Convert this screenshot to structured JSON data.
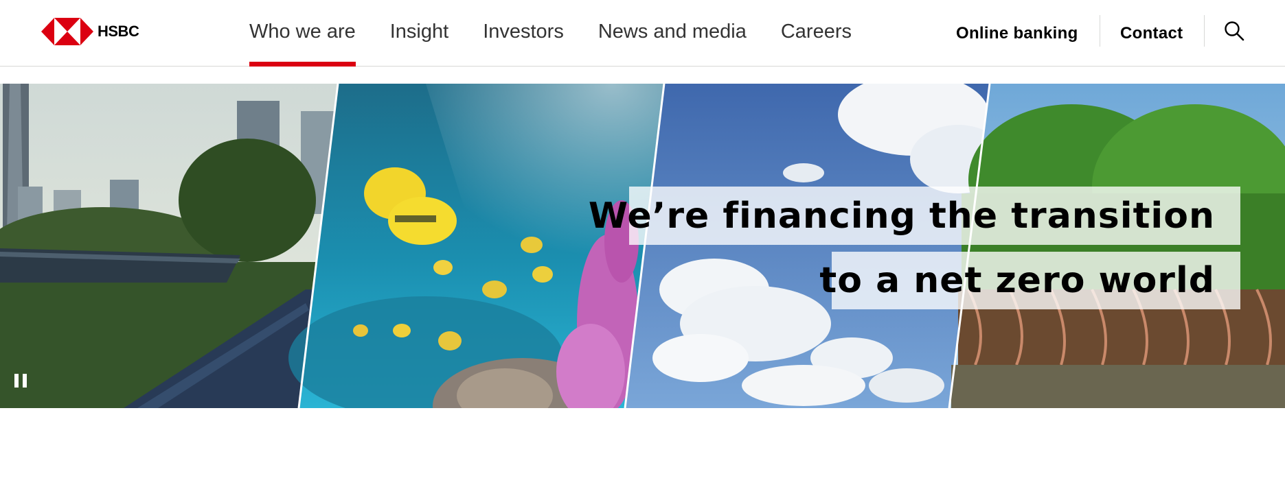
{
  "brand": {
    "name": "HSBC",
    "logo_red": "#db0011"
  },
  "nav": {
    "items": [
      {
        "label": "Who we are",
        "active": true
      },
      {
        "label": "Insight"
      },
      {
        "label": "Investors"
      },
      {
        "label": "News and media"
      },
      {
        "label": "Careers"
      }
    ]
  },
  "utility": {
    "online_banking": "Online banking",
    "contact": "Contact",
    "search_icon": "search-icon"
  },
  "hero": {
    "headline_line1": "We’re financing the transition",
    "headline_line2": "to a net zero world",
    "pause_icon": "pause-icon"
  }
}
